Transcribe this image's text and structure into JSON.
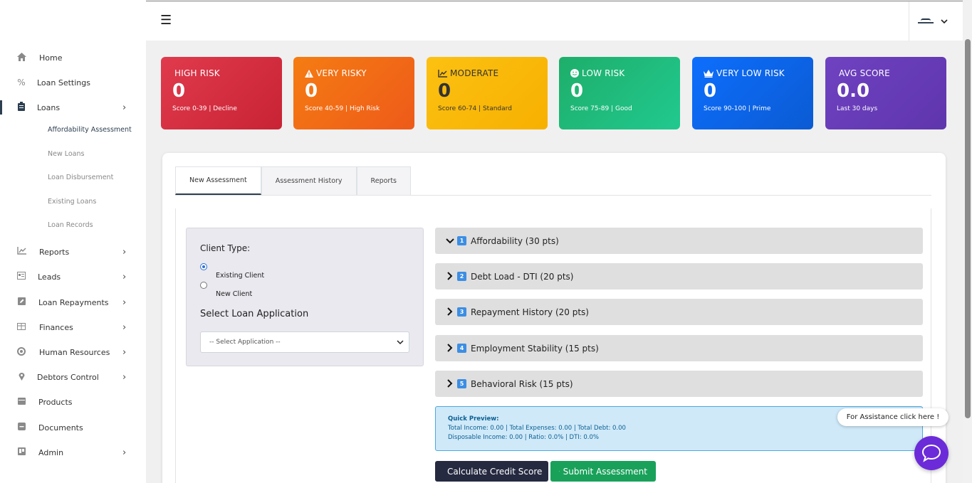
{
  "sidebar": {
    "items": [
      {
        "label": "Home",
        "icon": "home-icon"
      },
      {
        "label": "Loan Settings",
        "icon": "percent-icon"
      },
      {
        "label": "Loans",
        "icon": "clipboard-icon"
      },
      {
        "label": "Reports",
        "icon": "chart-line-icon"
      },
      {
        "label": "Leads",
        "icon": "address-card-icon"
      },
      {
        "label": "Loan Repayments",
        "icon": "edit-icon"
      },
      {
        "label": "Finances",
        "icon": "table-icon"
      },
      {
        "label": "Human Resources",
        "icon": "circle-icon"
      },
      {
        "label": "Debtors Control",
        "icon": "map-pin-icon"
      },
      {
        "label": "Products",
        "icon": "calendar-icon"
      },
      {
        "label": "Documents",
        "icon": "minus-square-icon"
      },
      {
        "label": "Admin",
        "icon": "trello-icon"
      }
    ],
    "loan_subitems": [
      "Affordability Assessment",
      "New Loans",
      "Loan Disbursement",
      "Existing Loans",
      "Loan Records"
    ]
  },
  "header": {
    "menu_icon": "hamburger-icon"
  },
  "cards": [
    {
      "title": "HIGH RISK",
      "value": "0",
      "sub": "Score 0-39 | Decline",
      "color": "#dc3545",
      "icon": ""
    },
    {
      "title": "VERY RISKY",
      "value": "0",
      "sub": "Score 40-59 | High Risk",
      "color": "#f26b10",
      "icon": "warning-icon"
    },
    {
      "title": "MODERATE",
      "value": "0",
      "sub": "Score 60-74 | Standard",
      "color": "#fbbb0b",
      "icon": "chart-line-icon"
    },
    {
      "title": "LOW RISK",
      "value": "0",
      "sub": "Score 75-89 | Good",
      "color": "#1fb972",
      "icon": "smile-icon"
    },
    {
      "title": "VERY LOW RISK",
      "value": "0",
      "sub": "Score 90-100 | Prime",
      "color": "#0d6ef0",
      "icon": "crown-icon"
    },
    {
      "title": "AVG SCORE",
      "value": "0.0",
      "sub": "Last 30 days",
      "color": "#6c3cb9",
      "icon": ""
    }
  ],
  "tabs": [
    "New Assessment",
    "Assessment History",
    "Reports"
  ],
  "form": {
    "client_type_label": "Client Type:",
    "options": [
      "Existing Client",
      "New Client"
    ],
    "select_label": "Select Loan Application",
    "select_value": "-- Select Application --"
  },
  "accordion": [
    {
      "num": "1",
      "title": "Affordability (30 pts)",
      "expanded": true
    },
    {
      "num": "2",
      "title": "Debt Load - DTI (20 pts)",
      "expanded": false
    },
    {
      "num": "3",
      "title": "Repayment History (20 pts)",
      "expanded": false
    },
    {
      "num": "4",
      "title": "Employment Stability (15 pts)",
      "expanded": false
    },
    {
      "num": "5",
      "title": "Behavioral Risk (15 pts)",
      "expanded": false
    }
  ],
  "preview": {
    "title": "Quick Preview:",
    "line1": "Total Income: 0.00 | Total Expenses: 0.00 | Total Debt: 0.00",
    "line2": "Disposable Income: 0.00 | Ratio: 0.0% | DTI: 0.0%"
  },
  "buttons": {
    "calculate": "Calculate Credit Score",
    "submit": "Submit Assessment"
  },
  "help": {
    "text": "For Assistance click here !"
  }
}
